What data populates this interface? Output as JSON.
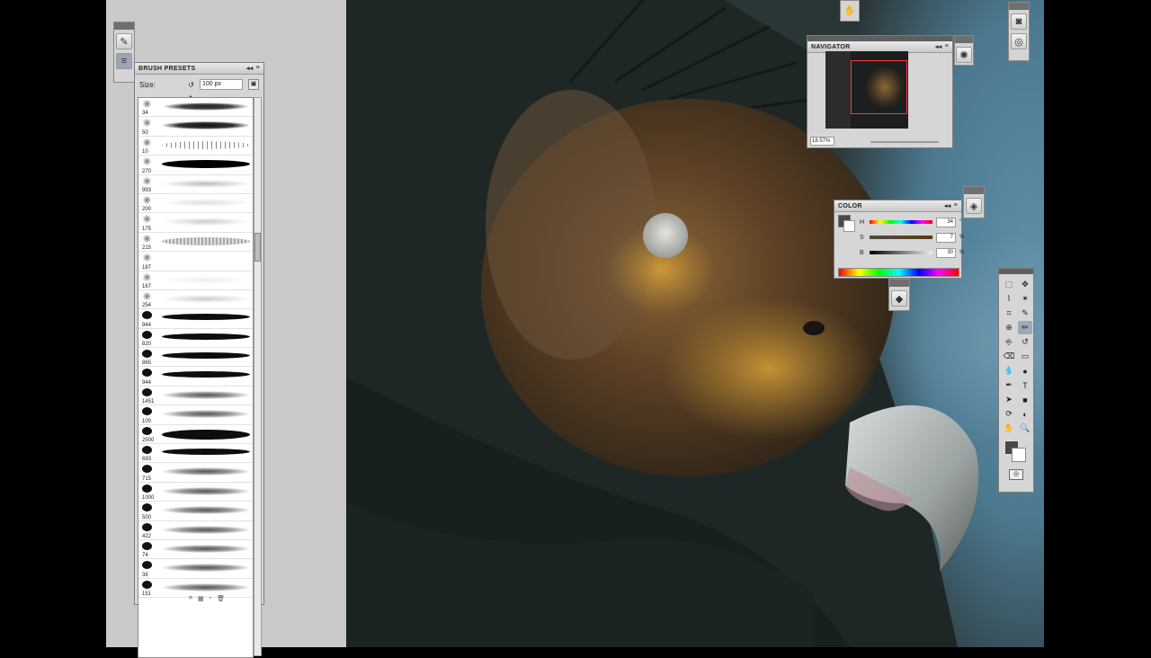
{
  "brush_presets": {
    "title": "BRUSH PRESETS",
    "size_label": "Size:",
    "size_value": "100 px",
    "brush_sizes": [
      "34",
      "50",
      "10",
      "270",
      "993",
      "200",
      "175",
      "215",
      "187",
      "167",
      "254",
      "944",
      "820",
      "865",
      "944",
      "1451",
      "100",
      "2500",
      "693",
      "715",
      "1000",
      "500",
      "422",
      "74",
      "38",
      "151"
    ]
  },
  "navigator": {
    "title": "NAVIGATOR",
    "zoom": "18.57%"
  },
  "color": {
    "title": "COLOR",
    "h_label": "H",
    "h_value": "34",
    "h_unit": "°",
    "s_label": "S",
    "s_value": "7",
    "s_unit": "%",
    "b_label": "B",
    "b_value": "30",
    "b_unit": "%"
  },
  "tools": [
    "marquee-icon",
    "move-icon",
    "lasso-icon",
    "magic-wand-icon",
    "crop-icon",
    "eyedropper-icon",
    "healing-icon",
    "brush-icon",
    "clone-stamp-icon",
    "history-brush-icon",
    "eraser-icon",
    "gradient-icon",
    "blur-icon",
    "dodge-icon",
    "pen-icon",
    "type-icon",
    "path-select-icon",
    "shape-icon",
    "3d-rotate-icon",
    "3d-orbit-icon",
    "hand-icon",
    "zoom-icon"
  ],
  "colors": {
    "foreground": "#4a4747",
    "background": "#ffffff",
    "workspace": "#c9c9c9"
  }
}
